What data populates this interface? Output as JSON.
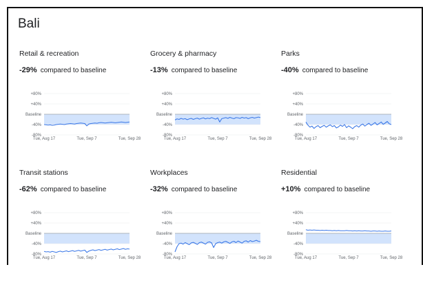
{
  "region": "Bali",
  "compare_text": "compared to baseline",
  "chart_data": [
    {
      "type": "line",
      "title": "Retail & recreation",
      "change_label": "-29%",
      "y_tick_labels": [
        "+80%",
        "+40%",
        "Baseline",
        "-40%",
        "-80%"
      ],
      "x_tick_labels": [
        "Tue, Aug 17",
        "Tue, Sep 7",
        "Tue, Sep 28"
      ],
      "ylim": [
        -80,
        80
      ],
      "baseline_band": -40,
      "series": [
        {
          "values": [
            -40,
            -41,
            -42,
            -41,
            -43,
            -42,
            -40,
            -39,
            -38,
            -39,
            -40,
            -38,
            -37,
            -36,
            -37,
            -38,
            -36,
            -35,
            -34,
            -35,
            -36,
            -45,
            -38,
            -36,
            -35,
            -34,
            -35,
            -33,
            -32,
            -33,
            -34,
            -33,
            -32,
            -31,
            -32,
            -33,
            -32,
            -31,
            -30,
            -31,
            -32,
            -31,
            -30
          ]
        }
      ],
      "color": "#3b78e7"
    },
    {
      "type": "line",
      "title": "Grocery & pharmacy",
      "change_label": "-13%",
      "y_tick_labels": [
        "+80%",
        "+40%",
        "Baseline",
        "-40%",
        "-80%"
      ],
      "x_tick_labels": [
        "Tue, Aug 17",
        "Tue, Sep 7",
        "Tue, Sep 28"
      ],
      "ylim": [
        -80,
        80
      ],
      "baseline_band": -40,
      "series": [
        {
          "values": [
            -22,
            -18,
            -20,
            -16,
            -19,
            -17,
            -21,
            -18,
            -16,
            -20,
            -17,
            -15,
            -19,
            -16,
            -14,
            -18,
            -15,
            -17,
            -13,
            -16,
            -19,
            -14,
            -30,
            -17,
            -15,
            -13,
            -16,
            -12,
            -15,
            -17,
            -13,
            -14,
            -16,
            -12,
            -15,
            -13,
            -17,
            -14,
            -12,
            -15,
            -13,
            -11,
            -13
          ]
        }
      ],
      "color": "#3b78e7"
    },
    {
      "type": "line",
      "title": "Parks",
      "change_label": "-40%",
      "y_tick_labels": [
        "+80%",
        "+40%",
        "Baseline",
        "-40%",
        "-80%"
      ],
      "x_tick_labels": [
        "Tue, Aug 17",
        "Tue, Sep 7",
        "Tue, Sep 28"
      ],
      "ylim": [
        -80,
        80
      ],
      "baseline_band": -40,
      "series": [
        {
          "values": [
            -30,
            -42,
            -50,
            -46,
            -55,
            -48,
            -44,
            -52,
            -47,
            -43,
            -50,
            -45,
            -41,
            -48,
            -44,
            -53,
            -49,
            -42,
            -47,
            -40,
            -52,
            -45,
            -50,
            -56,
            -48,
            -44,
            -50,
            -42,
            -38,
            -46,
            -40,
            -35,
            -43,
            -38,
            -32,
            -41,
            -36,
            -30,
            -39,
            -34,
            -28,
            -37,
            -40
          ]
        }
      ],
      "color": "#3b78e7"
    },
    {
      "type": "line",
      "title": "Transit stations",
      "change_label": "-62%",
      "y_tick_labels": [
        "+80%",
        "+40%",
        "Baseline",
        "-40%",
        "-80%"
      ],
      "x_tick_labels": [
        "Tue, Aug 17",
        "Tue, Sep 7",
        "Tue, Sep 28"
      ],
      "ylim": [
        -80,
        80
      ],
      "baseline_band": -40,
      "series": [
        {
          "values": [
            -70,
            -72,
            -71,
            -73,
            -70,
            -72,
            -74,
            -71,
            -69,
            -72,
            -70,
            -68,
            -71,
            -69,
            -67,
            -70,
            -68,
            -66,
            -69,
            -67,
            -65,
            -74,
            -69,
            -66,
            -64,
            -67,
            -65,
            -63,
            -66,
            -64,
            -62,
            -65,
            -63,
            -61,
            -64,
            -62,
            -60,
            -63,
            -61,
            -59,
            -62,
            -60,
            -61
          ]
        }
      ],
      "color": "#3b78e7"
    },
    {
      "type": "line",
      "title": "Workplaces",
      "change_label": "-32%",
      "y_tick_labels": [
        "+80%",
        "+40%",
        "Baseline",
        "-40%",
        "-80%"
      ],
      "x_tick_labels": [
        "Tue, Aug 17",
        "Tue, Sep 7",
        "Tue, Sep 28"
      ],
      "ylim": [
        -80,
        80
      ],
      "baseline_band": -40,
      "series": [
        {
          "values": [
            -72,
            -52,
            -40,
            -38,
            -42,
            -36,
            -40,
            -44,
            -37,
            -35,
            -39,
            -43,
            -36,
            -34,
            -38,
            -42,
            -35,
            -33,
            -37,
            -55,
            -40,
            -36,
            -34,
            -38,
            -33,
            -31,
            -35,
            -39,
            -33,
            -31,
            -36,
            -30,
            -34,
            -38,
            -31,
            -29,
            -34,
            -28,
            -32,
            -30,
            -27,
            -31,
            -32
          ]
        }
      ],
      "color": "#3b78e7"
    },
    {
      "type": "line",
      "title": "Residential",
      "change_label": "+10%",
      "y_tick_labels": [
        "+80%",
        "+40%",
        "Baseline",
        "-40%",
        "-80%"
      ],
      "x_tick_labels": [
        "Tue, Aug 17",
        "Tue, Sep 7",
        "Tue, Sep 28"
      ],
      "ylim": [
        -80,
        80
      ],
      "baseline_band": -40,
      "series": [
        {
          "values": [
            14,
            12,
            13,
            12,
            13,
            12,
            12,
            11,
            12,
            11,
            12,
            11,
            11,
            10,
            11,
            10,
            11,
            10,
            10,
            10,
            11,
            10,
            10,
            9,
            10,
            9,
            10,
            9,
            9,
            10,
            9,
            9,
            8,
            9,
            9,
            8,
            9,
            8,
            8,
            9,
            8,
            8,
            9
          ]
        }
      ],
      "color": "#3b78e7"
    }
  ]
}
